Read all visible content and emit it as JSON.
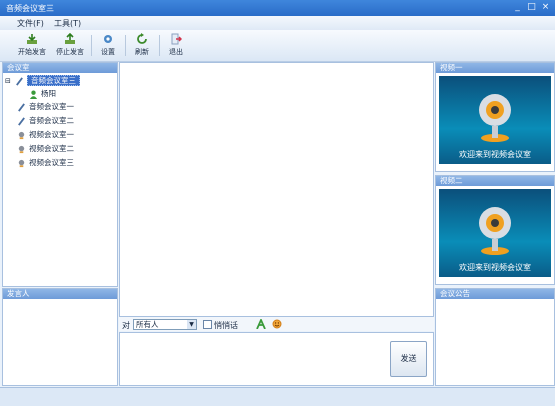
{
  "window": {
    "title": "音频会议室三",
    "min": "_",
    "max": "□",
    "close": "×"
  },
  "menu": {
    "file": "文件(F)",
    "tools": "工具(T)"
  },
  "toolbar": {
    "start": "开始发言",
    "stop": "停止发言",
    "settings": "设置",
    "refresh": "刷新",
    "exit": "退出"
  },
  "rooms": {
    "header": "会议室",
    "tree_toggle": "⊟",
    "items": [
      {
        "label": "音频会议室三",
        "icon": "mic-icon"
      },
      {
        "label": "杨阳",
        "icon": "user-icon"
      },
      {
        "label": "音频会议室一",
        "icon": "mic-icon"
      },
      {
        "label": "音频会议室二",
        "icon": "mic-icon"
      },
      {
        "label": "视频会议室一",
        "icon": "camera-icon"
      },
      {
        "label": "视频会议室二",
        "icon": "camera-icon"
      },
      {
        "label": "视频会议室三",
        "icon": "camera-icon"
      }
    ]
  },
  "speakers": {
    "header": "发言人"
  },
  "chat": {
    "to_label": "对",
    "recipient": "所有人",
    "whisper": "悄悄话",
    "send": "发送"
  },
  "video1": {
    "header": "视频一",
    "caption": "欢迎来到视频会议室"
  },
  "video2": {
    "header": "视频二",
    "caption": "欢迎来到视频会议室"
  },
  "notice": {
    "header": "会议公告"
  }
}
